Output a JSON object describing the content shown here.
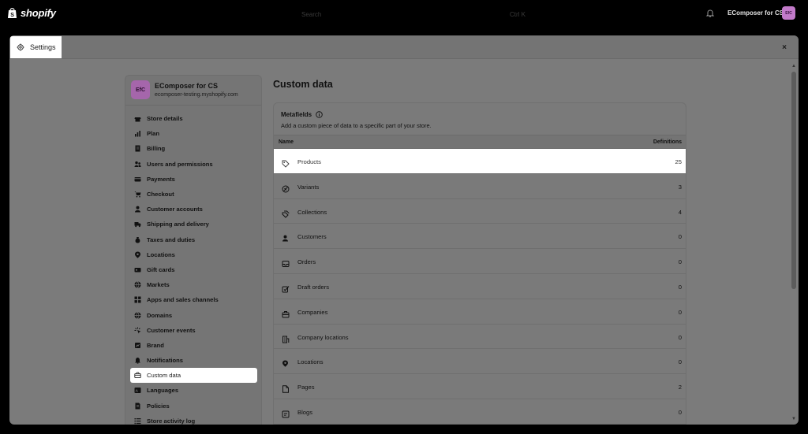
{
  "topbar": {
    "logo_text": "shopify",
    "search_placeholder": "Search",
    "search_shortcut": "Ctrl K",
    "store_name": "EComposer for CS",
    "avatar_initials": "EfC"
  },
  "modal": {
    "title": "Settings",
    "close_label": "×"
  },
  "store": {
    "initials": "EfC",
    "name": "EComposer for CS",
    "domain": "ecomposer-testing.myshopify.com"
  },
  "sidebar": {
    "items": [
      {
        "label": "Store details",
        "icon": "store-icon"
      },
      {
        "label": "Plan",
        "icon": "chart-icon"
      },
      {
        "label": "Billing",
        "icon": "receipt-icon"
      },
      {
        "label": "Users and permissions",
        "icon": "users-icon"
      },
      {
        "label": "Payments",
        "icon": "payments-icon"
      },
      {
        "label": "Checkout",
        "icon": "cart-icon"
      },
      {
        "label": "Customer accounts",
        "icon": "person-icon"
      },
      {
        "label": "Shipping and delivery",
        "icon": "truck-icon"
      },
      {
        "label": "Taxes and duties",
        "icon": "money-bag-icon"
      },
      {
        "label": "Locations",
        "icon": "location-icon"
      },
      {
        "label": "Gift cards",
        "icon": "gift-card-icon"
      },
      {
        "label": "Markets",
        "icon": "globe-icon"
      },
      {
        "label": "Apps and sales channels",
        "icon": "apps-icon"
      },
      {
        "label": "Domains",
        "icon": "globe-icon"
      },
      {
        "label": "Customer events",
        "icon": "cursor-icon"
      },
      {
        "label": "Brand",
        "icon": "brand-icon"
      },
      {
        "label": "Notifications",
        "icon": "bell-icon"
      },
      {
        "label": "Custom data",
        "icon": "database-icon",
        "active": true
      },
      {
        "label": "Languages",
        "icon": "language-icon"
      },
      {
        "label": "Policies",
        "icon": "policy-icon"
      },
      {
        "label": "Store activity log",
        "icon": "list-icon"
      }
    ]
  },
  "main": {
    "title": "Custom data",
    "metafields": {
      "heading": "Metafields",
      "description": "Add a custom piece of data to a specific part of your store.",
      "col_name": "Name",
      "col_definitions": "Definitions",
      "rows": [
        {
          "name": "Products",
          "count": "25",
          "icon": "tag-icon",
          "highlighted": true
        },
        {
          "name": "Variants",
          "count": "3",
          "icon": "variant-icon"
        },
        {
          "name": "Collections",
          "count": "4",
          "icon": "collection-icon"
        },
        {
          "name": "Customers",
          "count": "0",
          "icon": "person-icon"
        },
        {
          "name": "Orders",
          "count": "0",
          "icon": "inbox-icon"
        },
        {
          "name": "Draft orders",
          "count": "0",
          "icon": "draft-icon"
        },
        {
          "name": "Companies",
          "count": "0",
          "icon": "company-icon"
        },
        {
          "name": "Company locations",
          "count": "0",
          "icon": "building-icon"
        },
        {
          "name": "Locations",
          "count": "0",
          "icon": "location-icon"
        },
        {
          "name": "Pages",
          "count": "2",
          "icon": "page-icon"
        },
        {
          "name": "Blogs",
          "count": "0",
          "icon": "blog-icon"
        }
      ]
    }
  },
  "colors": {
    "overlay": "#7b7b7b",
    "avatar": "#c27ac9",
    "highlight": "#ffffff"
  }
}
